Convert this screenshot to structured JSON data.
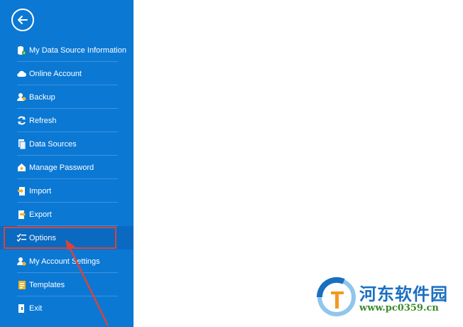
{
  "sidebar": {
    "back_icon": "back-arrow-circle-icon",
    "items": [
      {
        "label": "My Data Source Information",
        "icon": "database-info-icon"
      },
      {
        "label": "Online Account",
        "icon": "cloud-icon"
      },
      {
        "label": "Backup",
        "icon": "backup-users-icon"
      },
      {
        "label": "Refresh",
        "icon": "refresh-icon"
      },
      {
        "label": "Data Sources",
        "icon": "data-sources-icon"
      },
      {
        "label": "Manage Password",
        "icon": "password-icon"
      },
      {
        "label": "Import",
        "icon": "import-icon"
      },
      {
        "label": "Export",
        "icon": "export-icon"
      },
      {
        "label": "Options",
        "icon": "options-checklist-icon"
      },
      {
        "label": "My Account Settings",
        "icon": "account-settings-icon"
      },
      {
        "label": "Templates",
        "icon": "templates-icon"
      },
      {
        "label": "Exit",
        "icon": "exit-icon"
      }
    ],
    "selected": "Options"
  },
  "watermark": {
    "title": "河东软件园",
    "url": "www.pc0359.cn"
  },
  "colors": {
    "sidebar_bg": "#0b78d4",
    "selected_bg": "#0a6ac1",
    "annotation": "#d9443b",
    "watermark_blue": "#1a6fc0",
    "watermark_green": "#3a8a2b"
  }
}
